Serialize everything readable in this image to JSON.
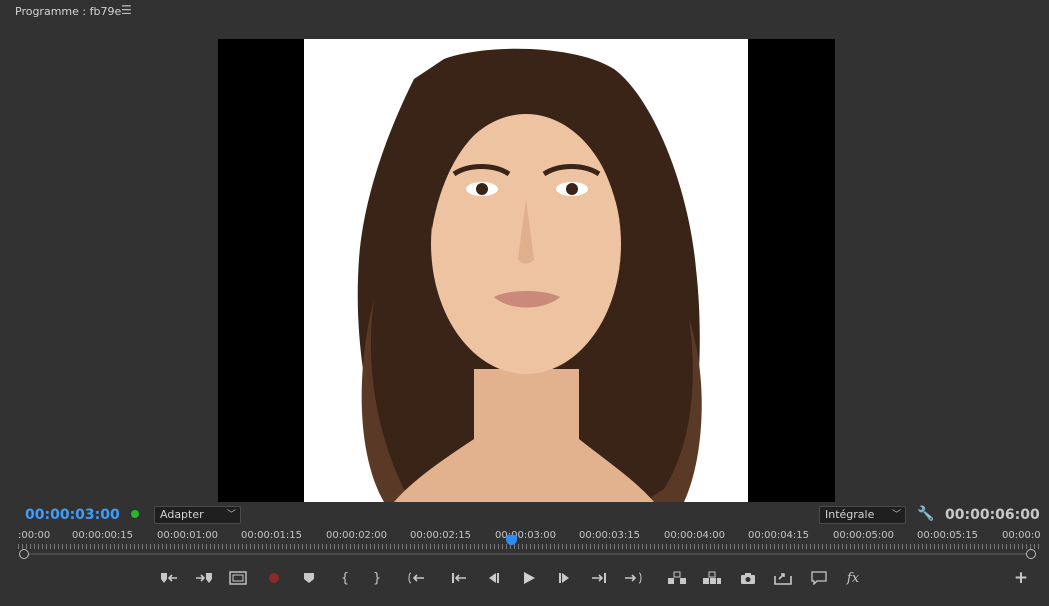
{
  "panel": {
    "title": "Programme : fb79e",
    "menu_icon": "hamburger-menu-icon"
  },
  "playback": {
    "current_timecode": "00:00:03:00",
    "duration_timecode": "00:00:06:00",
    "zoom_select": "Adapter",
    "resolution_select": "Intégrale"
  },
  "ruler": {
    "labels": [
      ":00:00",
      "00:00:00:15",
      "00:00:01:00",
      "00:00:01:15",
      "00:00:02:00",
      "00:00:02:15",
      "00:00:03:00",
      "00:00:03:15",
      "00:00:04:00",
      "00:00:04:15",
      "00:00:05:00",
      "00:00:05:15",
      "00:00:0"
    ]
  },
  "controls": [
    {
      "name": "mark-in-button",
      "icon": "mark-in-icon"
    },
    {
      "name": "mark-out-button",
      "icon": "mark-out-icon"
    },
    {
      "name": "safe-margins-button",
      "icon": "safe-margins-icon"
    },
    {
      "name": "record-button",
      "icon": "record-icon"
    },
    {
      "name": "add-marker-button",
      "icon": "marker-icon"
    },
    {
      "name": "mark-in-brace-button",
      "icon": "brace-open-icon"
    },
    {
      "name": "mark-out-brace-button",
      "icon": "brace-close-icon"
    },
    {
      "name": "go-to-in-button",
      "icon": "go-to-in-icon"
    },
    {
      "name": "step-back-edit-button",
      "icon": "step-back-edit-icon"
    },
    {
      "name": "step-back-button",
      "icon": "step-back-icon"
    },
    {
      "name": "play-button",
      "icon": "play-icon"
    },
    {
      "name": "step-forward-button",
      "icon": "step-forward-icon"
    },
    {
      "name": "step-forward-edit-button",
      "icon": "step-forward-edit-icon"
    },
    {
      "name": "go-to-out-button",
      "icon": "go-to-out-icon"
    },
    {
      "name": "lift-button",
      "icon": "lift-icon"
    },
    {
      "name": "extract-button",
      "icon": "extract-icon"
    },
    {
      "name": "export-frame-button",
      "icon": "camera-icon"
    },
    {
      "name": "compare-view-button",
      "icon": "export-icon"
    },
    {
      "name": "comment-button",
      "icon": "comment-icon"
    },
    {
      "name": "effects-button",
      "icon": "fx-icon",
      "label": "fx"
    },
    {
      "name": "add-button",
      "icon": "plus-icon"
    }
  ],
  "colors": {
    "timecode_active": "#3d9dff",
    "status_dot": "#2bb52b",
    "record": "#8b2a2a"
  }
}
